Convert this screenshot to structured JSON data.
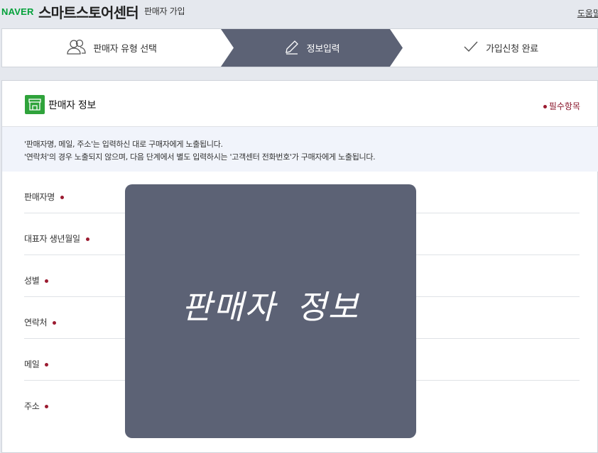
{
  "header": {
    "logo": "NAVER",
    "brand": "스마트스토어센터",
    "subtitle": "판매자 가입",
    "help": "도움말"
  },
  "steps": [
    {
      "label": "판매자 유형 선택",
      "icon": "users-icon",
      "active": false
    },
    {
      "label": "정보입력",
      "icon": "pencil-icon",
      "active": true
    },
    {
      "label": "가입신청 완료",
      "icon": "check-icon",
      "active": false
    }
  ],
  "section": {
    "title": "판매자 정보",
    "icon": "store-icon",
    "required_note": "필수항목",
    "notice_line1": "'판매자명, 메일, 주소'는 입력하신 대로 구매자에게 노출됩니다.",
    "notice_line2": "'연락처'의 경우 노출되지 않으며, 다음 단계에서 별도 입력하시는 '고객센터 전화번호'가 구매자에게 노출됩니다."
  },
  "fields": [
    {
      "label": "판매자명",
      "required": true
    },
    {
      "label": "대표자 생년월일",
      "required": true
    },
    {
      "label": "성별",
      "required": true
    },
    {
      "label": "연락처",
      "required": true
    },
    {
      "label": "메일",
      "required": true
    },
    {
      "label": "주소",
      "required": true
    }
  ],
  "overlay": {
    "text": "판매자 정보"
  },
  "colors": {
    "active_step": "#5c6275",
    "required": "#9b1b30",
    "brand_green": "#03a13a",
    "notice_bg": "#f1f4fb"
  }
}
